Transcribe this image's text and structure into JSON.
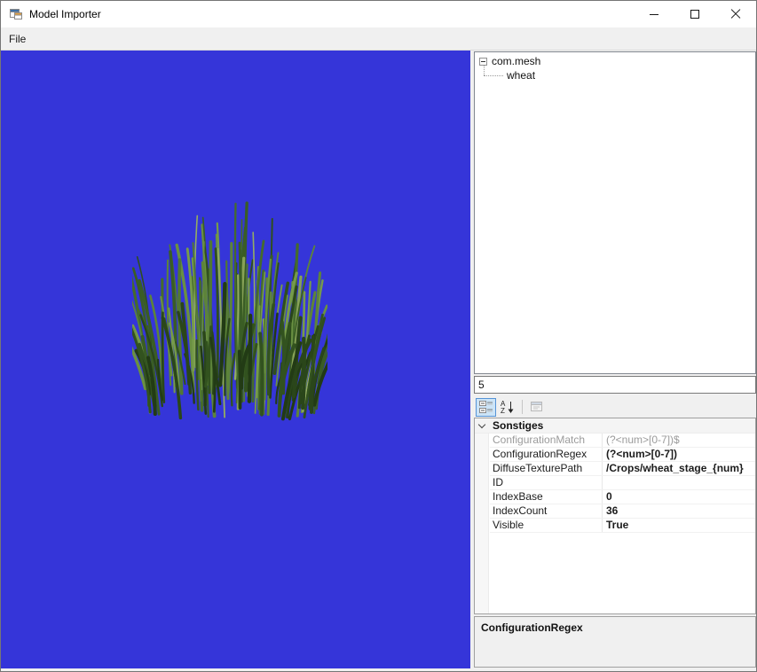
{
  "window": {
    "title": "Model Importer"
  },
  "menu": {
    "items": [
      {
        "label": "File"
      }
    ]
  },
  "icons": {
    "app": "form-icon",
    "minimize": "minimize-icon",
    "maximize": "maximize-icon",
    "close": "close-icon",
    "categorized": "categorized-view-icon",
    "alphabetical": "alphabetical-sort-icon",
    "property_pages": "property-pages-icon",
    "category_chevron": "chevron-down-icon",
    "tree_expander": "collapse-minus-icon"
  },
  "tree": {
    "root_label": "com.mesh",
    "children": [
      {
        "label": "wheat"
      }
    ]
  },
  "filter": {
    "value": "5"
  },
  "property_grid": {
    "toolbar": {
      "buttons": [
        {
          "name": "categorized",
          "pressed": true,
          "enabled": true
        },
        {
          "name": "alphabetical",
          "pressed": false,
          "enabled": true
        },
        {
          "name": "property-pages",
          "pressed": false,
          "enabled": false
        }
      ]
    },
    "category_label": "Sonstiges",
    "rows": [
      {
        "name": "ConfigurationMatch",
        "value": "(?<num>[0-7])$",
        "readonly": true,
        "modified": false
      },
      {
        "name": "ConfigurationRegex",
        "value": "(?<num>[0-7])",
        "readonly": false,
        "modified": true
      },
      {
        "name": "DiffuseTexturePath",
        "value": "/Crops/wheat_stage_{num}",
        "readonly": false,
        "modified": true
      },
      {
        "name": "ID",
        "value": "",
        "readonly": false,
        "modified": false
      },
      {
        "name": "IndexBase",
        "value": "0",
        "readonly": false,
        "modified": true
      },
      {
        "name": "IndexCount",
        "value": "36",
        "readonly": false,
        "modified": true
      },
      {
        "name": "Visible",
        "value": "True",
        "readonly": false,
        "modified": true
      }
    ],
    "description": {
      "title": "ConfigurationRegex"
    }
  },
  "colors": {
    "viewport_background": "#3535d9",
    "window_background": "#f0f0f0",
    "toolbar_pressed_bg": "#cce4f7",
    "toolbar_pressed_border": "#5694d6"
  }
}
